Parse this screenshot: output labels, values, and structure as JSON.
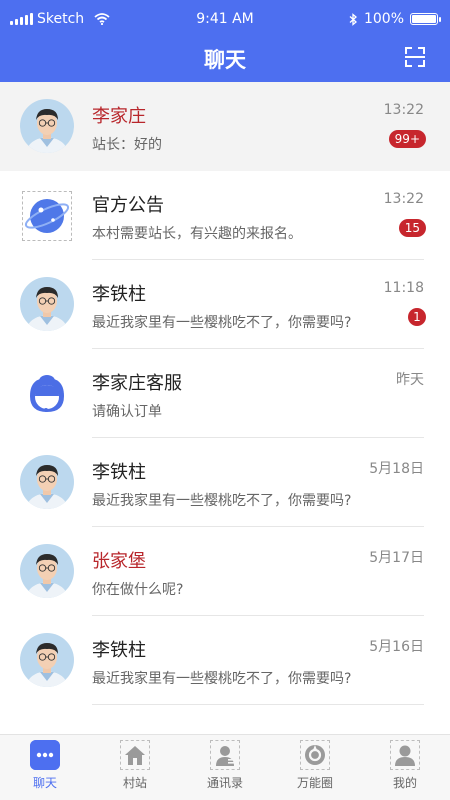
{
  "status_bar": {
    "carrier": "Sketch",
    "time": "9:41 AM",
    "battery": "100%"
  },
  "header": {
    "title": "聊天",
    "right_icon": "scan-icon"
  },
  "conversations": [
    {
      "name": "李家庄",
      "message": "站长：好的",
      "time": "13:22",
      "badge": "99+",
      "avatar": "avatar-man",
      "name_color": "#b8262b"
    },
    {
      "name": "官方公告",
      "message": "本村需要站长，有兴趣的来报名。",
      "time": "13:22",
      "badge": "15",
      "avatar": "planet-icon",
      "name_color": "#222222"
    },
    {
      "name": "李铁柱",
      "message": "最近我家里有一些樱桃吃不了，你需要吗?",
      "time": "11:18",
      "badge": "1",
      "avatar": "avatar-man",
      "name_color": "#222222"
    },
    {
      "name": "李家庄客服",
      "message": "请确认订单",
      "time": "昨天",
      "badge": "",
      "avatar": "support-agent-icon",
      "name_color": "#222222"
    },
    {
      "name": "李铁柱",
      "message": "最近我家里有一些樱桃吃不了，你需要吗?",
      "time": "5月18日",
      "badge": "",
      "avatar": "avatar-man",
      "name_color": "#222222"
    },
    {
      "name": "张家堡",
      "message": "你在做什么呢?",
      "time": "5月17日",
      "badge": "",
      "avatar": "avatar-man",
      "name_color": "#b8262b"
    },
    {
      "name": "李铁柱",
      "message": "最近我家里有一些樱桃吃不了，你需要吗?",
      "time": "5月16日",
      "badge": "",
      "avatar": "avatar-man",
      "name_color": "#222222"
    }
  ],
  "tabbar": [
    {
      "label": "聊天",
      "icon": "chat-icon",
      "active": true
    },
    {
      "label": "村站",
      "icon": "home-icon",
      "active": false
    },
    {
      "label": "通讯录",
      "icon": "contacts-icon",
      "active": false
    },
    {
      "label": "万能圈",
      "icon": "circle-icon",
      "active": false
    },
    {
      "label": "我的",
      "icon": "profile-icon",
      "active": false
    }
  ],
  "colors": {
    "accent": "#4d6ff0",
    "badge": "#c7262d",
    "highlight_name": "#b8262b"
  }
}
